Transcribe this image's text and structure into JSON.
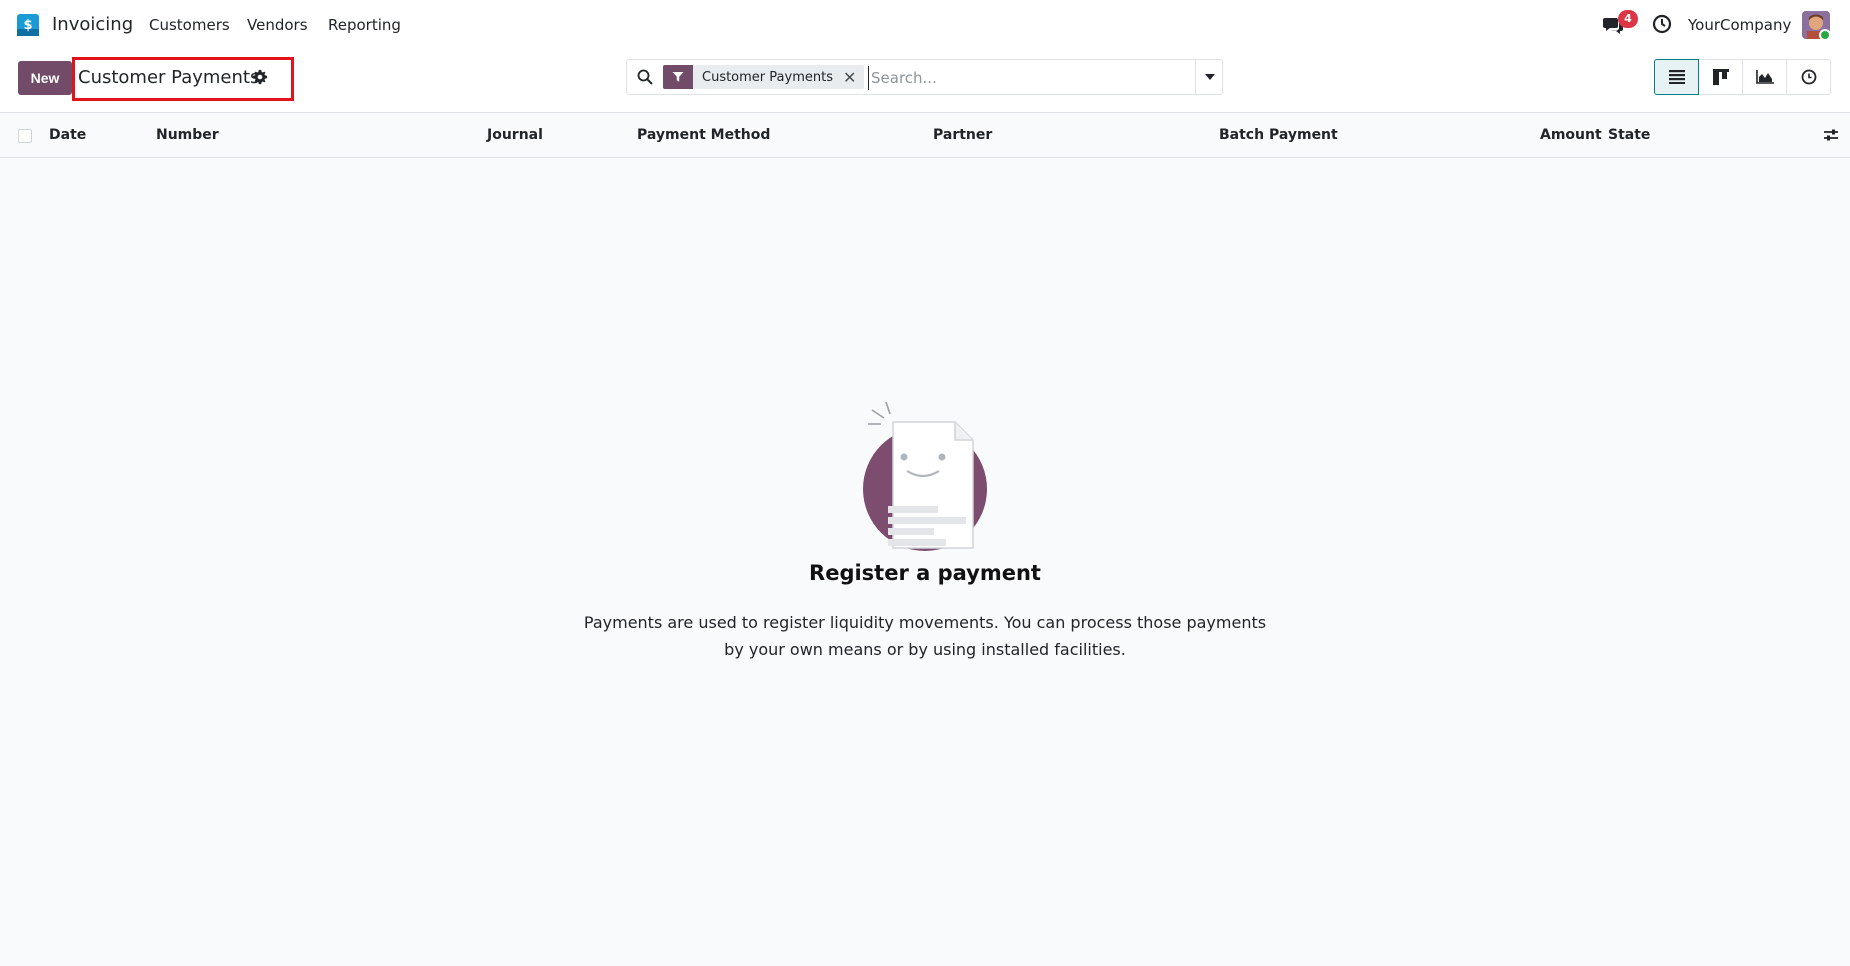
{
  "app": {
    "name": "Invoicing"
  },
  "menu": {
    "customers": "Customers",
    "vendors": "Vendors",
    "reporting": "Reporting"
  },
  "systray": {
    "chat_badge": "4",
    "company": "YourCompany"
  },
  "control": {
    "new_label": "New",
    "title": "Customer Payments"
  },
  "search": {
    "facet_label": "Customer Payments",
    "placeholder": "Search..."
  },
  "columns": {
    "date": "Date",
    "number": "Number",
    "journal": "Journal",
    "payment_method": "Payment Method",
    "partner": "Partner",
    "batch_payment": "Batch Payment",
    "amount": "Amount",
    "state": "State"
  },
  "empty": {
    "title": "Register a payment",
    "line1": "Payments are used to register liquidity movements. You can process those payments",
    "line2": "by your own means or by using installed facilities."
  },
  "colors": {
    "brand": "#714b67",
    "accent": "#017e84",
    "badge": "#dc3545",
    "highlight": "#e3131b"
  }
}
